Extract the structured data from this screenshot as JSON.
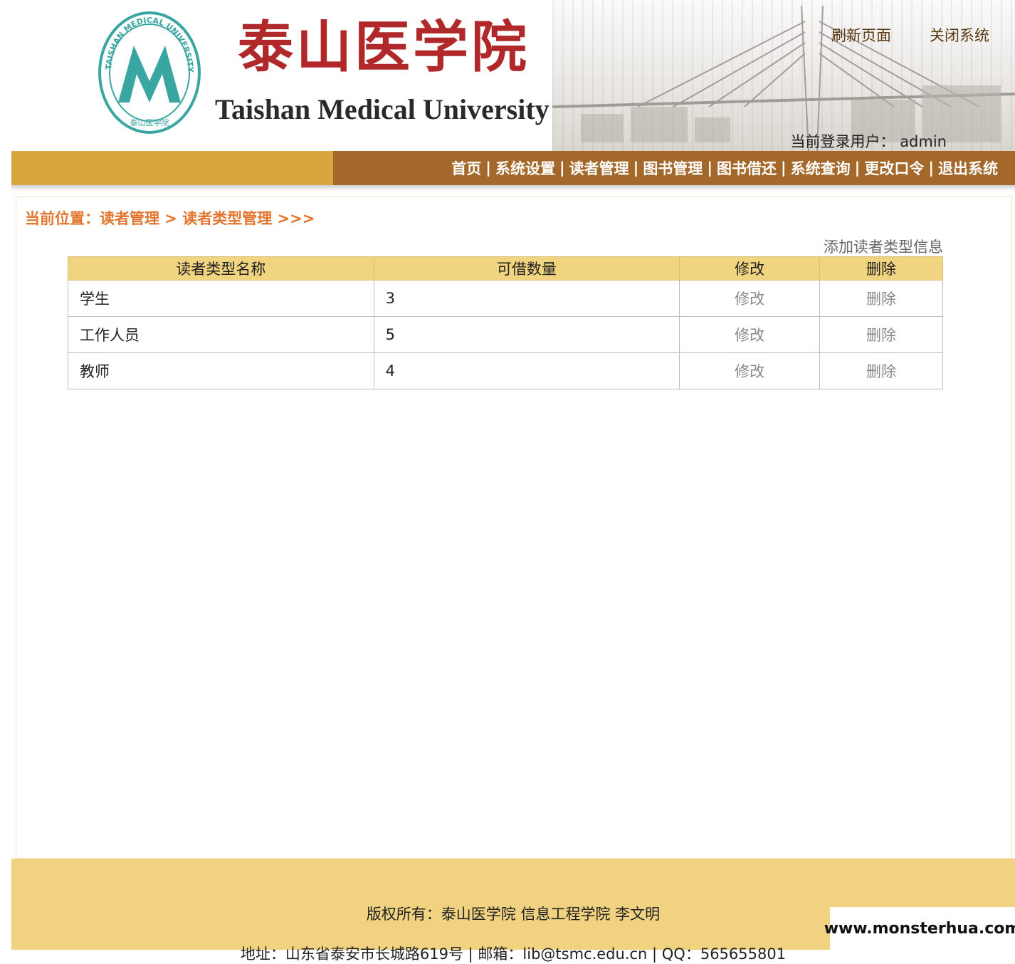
{
  "header": {
    "title_cn": "泰山医学院",
    "title_en": "Taishan Medical University",
    "logo_ring_text": "TAISHAN MEDICAL UNIVERSITY",
    "logo_bottom_text": "泰山医学院",
    "links": {
      "refresh": "刷新页面",
      "close": "关闭系统"
    },
    "login_user": "当前登录用户： admin"
  },
  "nav": {
    "items": [
      "首页",
      "系统设置",
      "读者管理",
      "图书管理",
      "图书借还",
      "系统查询",
      "更改口令",
      "退出系统"
    ],
    "separator": "|"
  },
  "breadcrumb": "当前位置：读者管理 > 读者类型管理 >>>",
  "add_link": "添加读者类型信息",
  "table": {
    "headers": [
      "读者类型名称",
      "可借数量",
      "修改",
      "删除"
    ],
    "rows": [
      {
        "name": "学生",
        "count": "3",
        "edit": "修改",
        "delete": "删除"
      },
      {
        "name": "工作人员",
        "count": "5",
        "edit": "修改",
        "delete": "删除"
      },
      {
        "name": "教师",
        "count": "4",
        "edit": "修改",
        "delete": "删除"
      }
    ]
  },
  "footer": {
    "copyright": "版权所有：泰山医学院 信息工程学院 李文明",
    "address": "地址：山东省泰安市长城路619号 | 邮箱：lib@tsmc.edu.cn  |  QQ：565655801"
  },
  "watermark": "www.monsterhua.com",
  "colors": {
    "brand_red": "#b0282a",
    "nav_brown": "#a3682a",
    "nav_gold": "#d7a63f",
    "table_header": "#f0d47f",
    "footer": "#f0d281",
    "breadcrumb": "#e2752e"
  }
}
